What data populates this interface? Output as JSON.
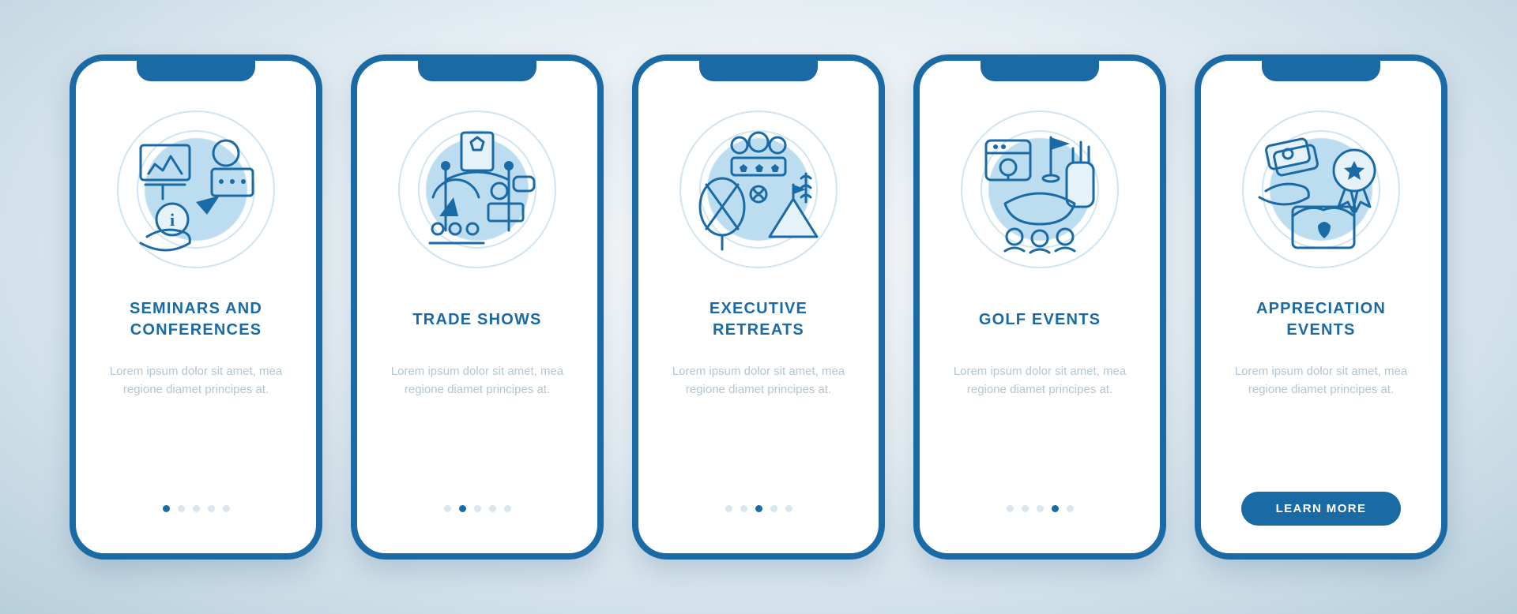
{
  "total_slides": 5,
  "cta_label": "LEARN MORE",
  "screens": [
    {
      "title": "SEMINARS AND CONFERENCES",
      "desc": "Lorem ipsum dolor sit amet, mea regione diamet principes at.",
      "icon": "seminars-icon",
      "active_index": 0,
      "show_cta": false
    },
    {
      "title": "TRADE SHOWS",
      "desc": "Lorem ipsum dolor sit amet, mea regione diamet principes at.",
      "icon": "tradeshow-icon",
      "active_index": 1,
      "show_cta": false
    },
    {
      "title": "EXECUTIVE RETREATS",
      "desc": "Lorem ipsum dolor sit amet, mea regione diamet principes at.",
      "icon": "retreats-icon",
      "active_index": 2,
      "show_cta": false
    },
    {
      "title": "GOLF EVENTS",
      "desc": "Lorem ipsum dolor sit amet, mea regione diamet principes at.",
      "icon": "golf-icon",
      "active_index": 3,
      "show_cta": false
    },
    {
      "title": "APPRECIATION EVENTS",
      "desc": "Lorem ipsum dolor sit amet, mea regione diamet principes at.",
      "icon": "appreciation-icon",
      "active_index": 4,
      "show_cta": true
    }
  ],
  "colors": {
    "primary": "#1a6aa6",
    "accent": "#bcdcef",
    "muted": "#b3c6d2"
  }
}
